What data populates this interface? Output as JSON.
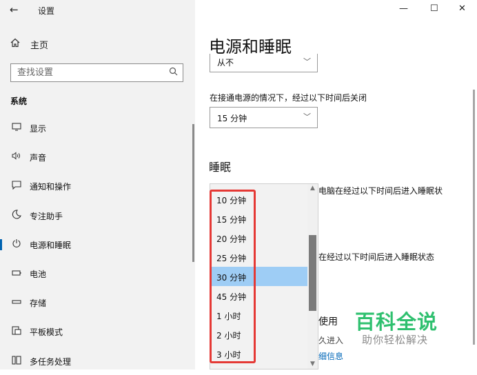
{
  "window": {
    "title": "设置",
    "back_icon": "←",
    "minimize_icon": "—",
    "maximize_icon": "☐",
    "close_icon": "✕"
  },
  "sidebar": {
    "home_label": "主页",
    "search_placeholder": "查找设置",
    "section_label": "系统",
    "items": [
      {
        "icon": "display-icon",
        "glyph": "▭",
        "label": "显示"
      },
      {
        "icon": "sound-icon",
        "glyph": "🔈",
        "label": "声音"
      },
      {
        "icon": "notifications-icon",
        "glyph": "☐",
        "label": "通知和操作"
      },
      {
        "icon": "focus-assist-icon",
        "glyph": "☽",
        "label": "专注助手"
      },
      {
        "icon": "power-icon",
        "glyph": "⏻",
        "label": "电源和睡眠",
        "selected": true
      },
      {
        "icon": "battery-icon",
        "glyph": "▭",
        "label": "电池"
      },
      {
        "icon": "storage-icon",
        "glyph": "▭",
        "label": "存储"
      },
      {
        "icon": "tablet-mode-icon",
        "glyph": "⧉",
        "label": "平板模式"
      },
      {
        "icon": "multitasking-icon",
        "glyph": "▤",
        "label": "多任务处理"
      }
    ]
  },
  "main": {
    "page_title": "电源和睡眠",
    "top_dropdown_value": "从不",
    "plugged_in_label": "在接通电源的情况下，经过以下时间后关闭",
    "plugged_in_value": "15 分钟",
    "sleep_heading": "睡眠",
    "sleep_text_1": "电脑在经过以下时间后进入睡眠状",
    "sleep_text_2": "在经过以下时间后进入睡眠状态",
    "partial_use": "使用",
    "partial_line2": "久进入",
    "partial_link": "细信息",
    "dropdown_options": [
      "10 分钟",
      "15 分钟",
      "20 分钟",
      "25 分钟",
      "30 分钟",
      "45 分钟",
      "1 小时",
      "2 小时",
      "3 小时"
    ],
    "selected_option": "30 分钟",
    "chevron": "﹀"
  },
  "watermark": {
    "title": "百科全说",
    "subtitle": "助你轻松解决"
  },
  "colors": {
    "accent": "#0063b1",
    "selection": "#9ecdf5",
    "highlight_box": "#e53935",
    "watermark": "#2fc06f"
  }
}
